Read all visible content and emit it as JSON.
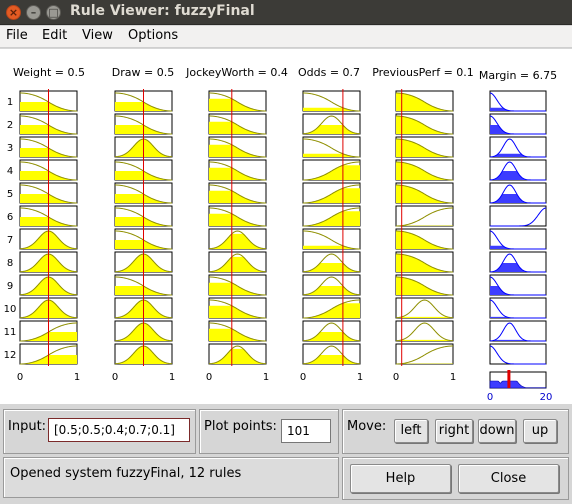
{
  "window": {
    "title": "Rule Viewer: fuzzyFinal"
  },
  "menu": [
    "File",
    "Edit",
    "View",
    "Options"
  ],
  "variables": [
    {
      "name": "Weight",
      "value": 0.5,
      "label": "Weight = 0.5"
    },
    {
      "name": "Draw",
      "value": 0.5,
      "label": "Draw = 0.5"
    },
    {
      "name": "JockeyWorth",
      "value": 0.4,
      "label": "JockeyWorth = 0.4"
    },
    {
      "name": "Odds",
      "value": 0.7,
      "label": "Odds = 0.7"
    },
    {
      "name": "PreviousPerf",
      "value": 0.1,
      "label": "PreviousPerf = 0.1"
    }
  ],
  "output": {
    "name": "Margin",
    "value": 6.75,
    "label": "Margin = 6.75",
    "range": [
      0,
      20
    ],
    "tick_labels": [
      "0",
      "20"
    ]
  },
  "input_axis": {
    "range": [
      0,
      1
    ],
    "tick_labels": [
      "0",
      "1"
    ]
  },
  "rule_numbers": [
    "1",
    "2",
    "3",
    "4",
    "5",
    "6",
    "7",
    "8",
    "9",
    "10",
    "11",
    "12"
  ],
  "rules": [
    {
      "in": [
        "low",
        "low",
        "low",
        "low",
        "low"
      ],
      "out": "low"
    },
    {
      "in": [
        "low",
        "low",
        "low",
        "mid",
        "low"
      ],
      "out": "low"
    },
    {
      "in": [
        "low",
        "mid",
        "low",
        "low",
        "low"
      ],
      "out": "mid"
    },
    {
      "in": [
        "low",
        "low",
        "low",
        "high",
        "low"
      ],
      "out": "mid"
    },
    {
      "in": [
        "low",
        "low",
        "low",
        "high",
        "low"
      ],
      "out": "mid"
    },
    {
      "in": [
        "low",
        "low",
        "low",
        "high",
        "high"
      ],
      "out": "high"
    },
    {
      "in": [
        "mid",
        "low",
        "mid",
        "low",
        "low"
      ],
      "out": "low"
    },
    {
      "in": [
        "mid",
        "mid",
        "mid",
        "mid",
        "low"
      ],
      "out": "mid"
    },
    {
      "in": [
        "mid",
        "low",
        "low",
        "mid",
        "low"
      ],
      "out": "low"
    },
    {
      "in": [
        "mid",
        "mid",
        "low",
        "high",
        "mid"
      ],
      "out": "low"
    },
    {
      "in": [
        "high",
        "mid",
        "low",
        "mid",
        "mid"
      ],
      "out": "mid"
    },
    {
      "in": [
        "high",
        "mid",
        "mid",
        "mid",
        "high"
      ],
      "out": "low"
    }
  ],
  "colors": {
    "fill": "#ffff00",
    "mf_line": "#8f8f00",
    "index_line": "#e00000",
    "out_line": "#0000ff",
    "agg_fill": "#3d3dff"
  },
  "controls": {
    "input_label": "Input:",
    "input_value": "[0.5;0.5;0.4;0.7;0.1]",
    "plot_points_label": "Plot points:",
    "plot_points_value": "101",
    "move_label": "Move:",
    "buttons": {
      "left": "left",
      "right": "right",
      "down": "down",
      "up": "up",
      "help": "Help",
      "close": "Close"
    },
    "status": "Opened system fuzzyFinal, 12 rules"
  }
}
